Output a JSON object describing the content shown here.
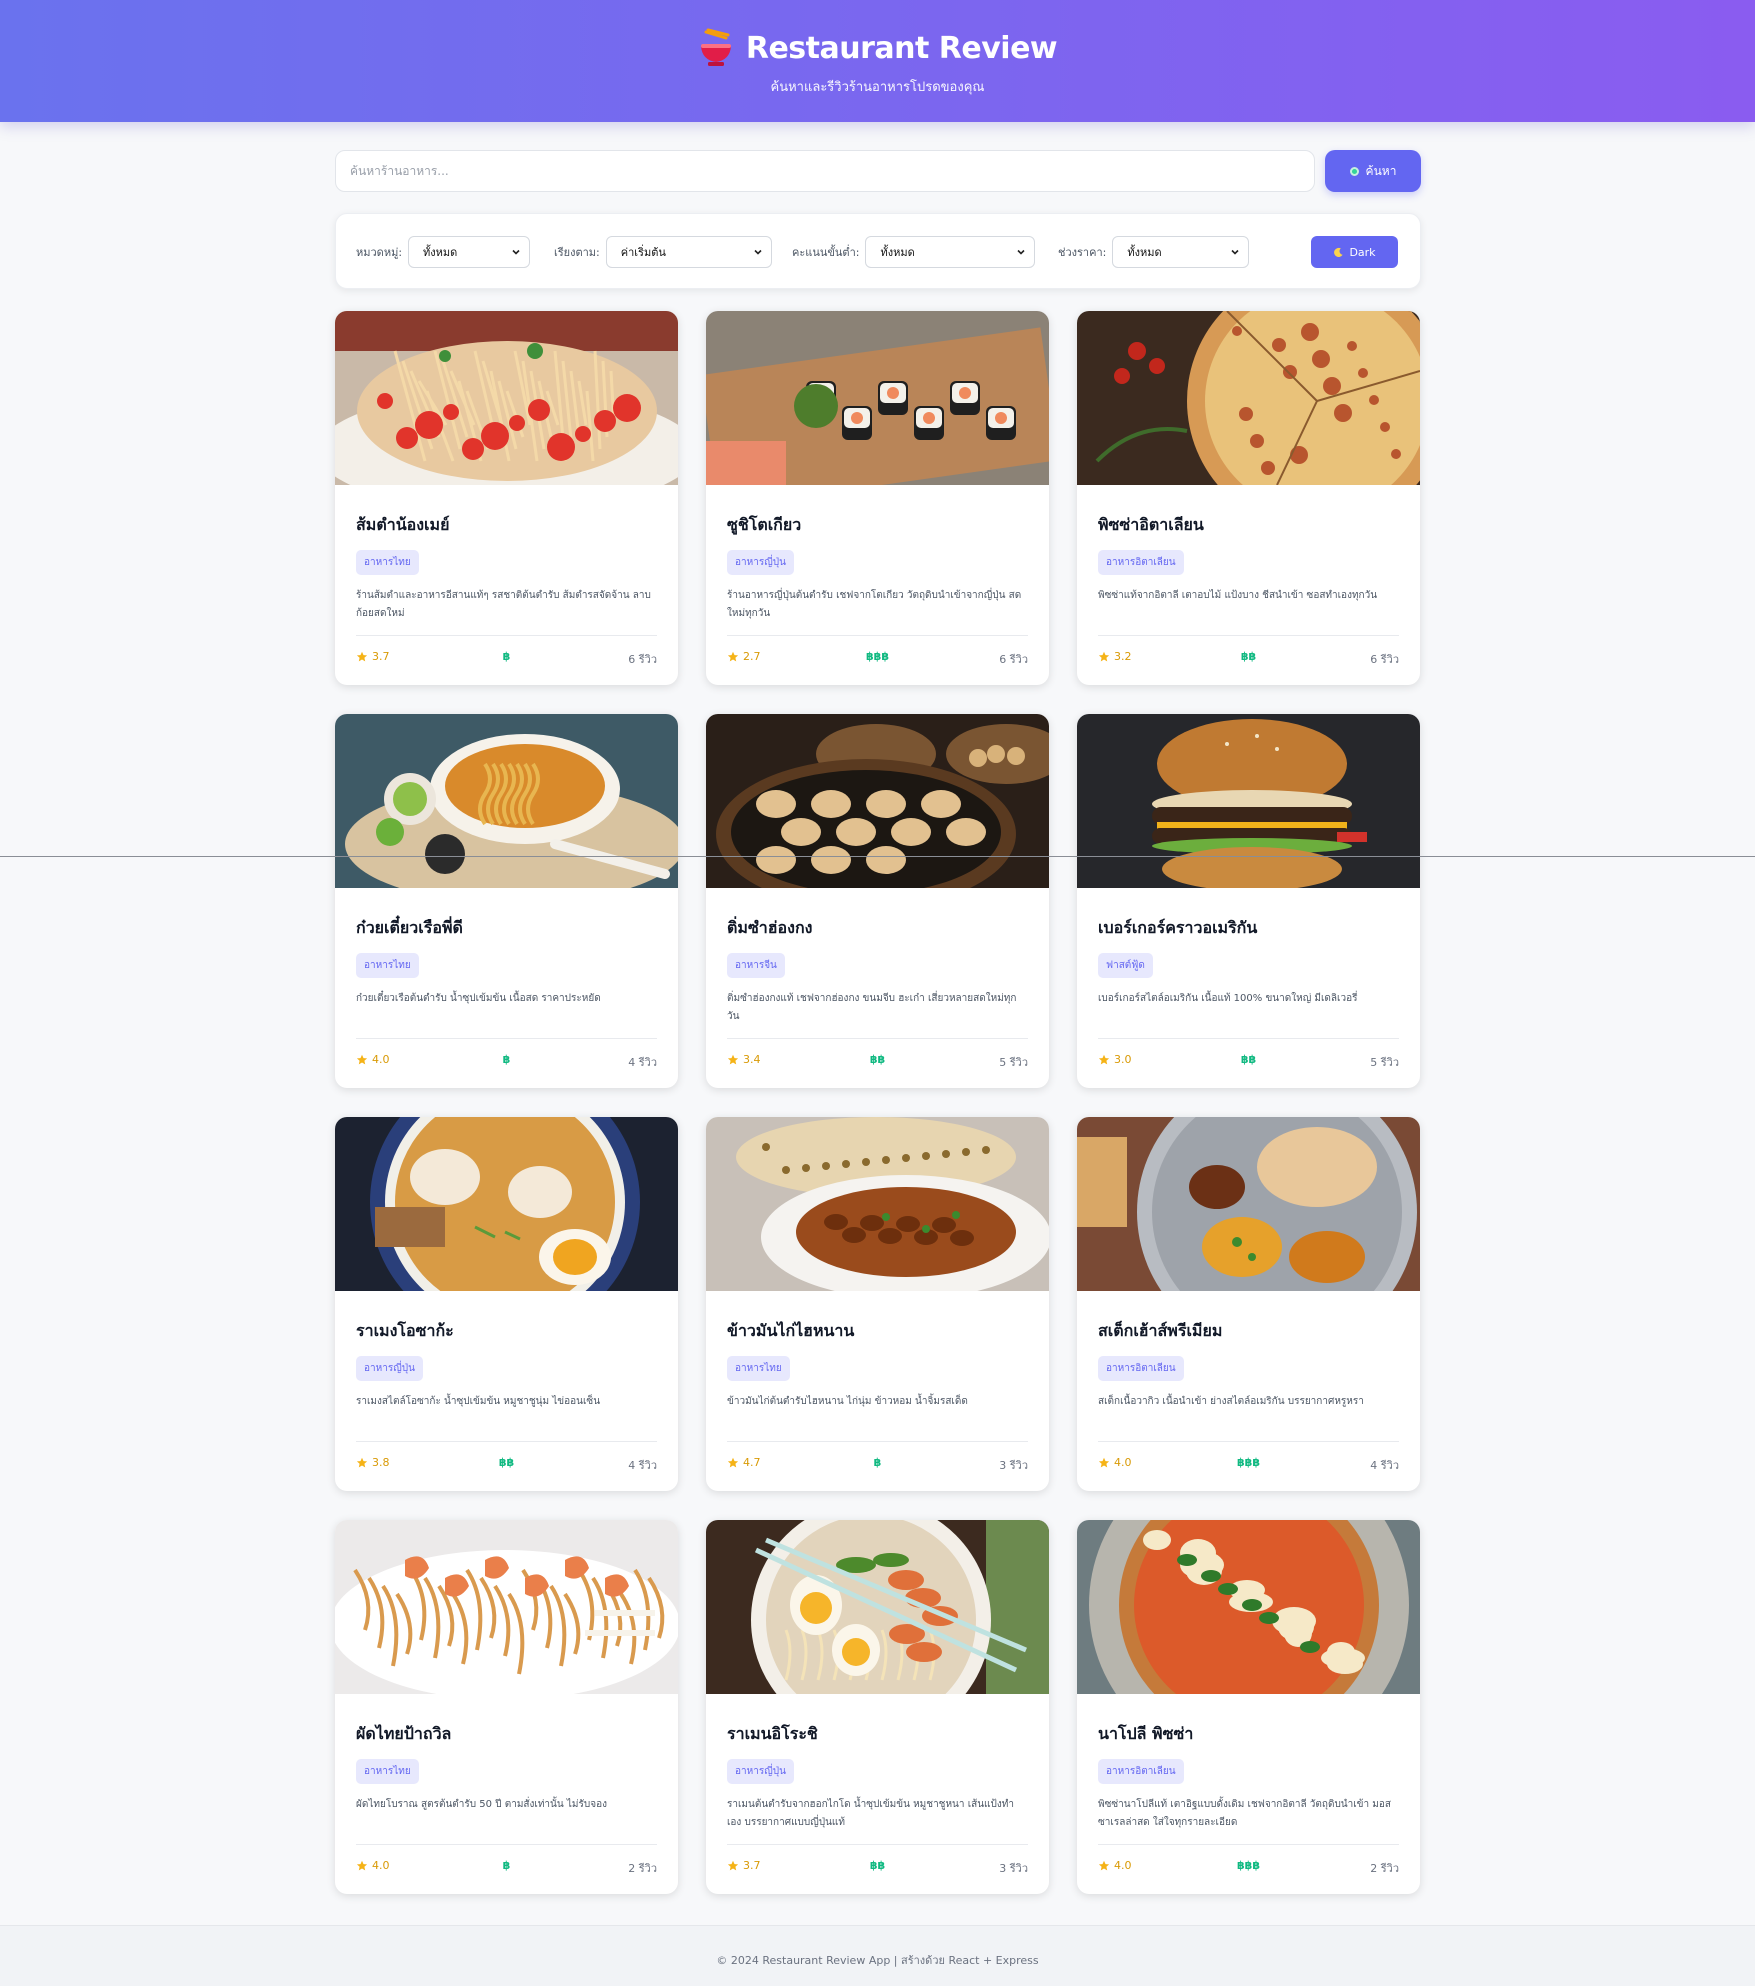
{
  "header": {
    "title": "Restaurant Review",
    "subtitle": "ค้นหาและรีวิวร้านอาหารโปรดของคุณ"
  },
  "search": {
    "placeholder": "ค้นหาร้านอาหาร...",
    "button_label": "ค้นหา"
  },
  "filters": {
    "category": {
      "label": "หมวดหมู่:",
      "value": "ทั้งหมด"
    },
    "sort": {
      "label": "เรียงตาม:",
      "value": "ค่าเริ่มต้น"
    },
    "min_rating": {
      "label": "คะแนนขั้นต่ำ:",
      "value": "ทั้งหมด"
    },
    "price_range": {
      "label": "ช่วงราคา:",
      "value": "ทั้งหมด"
    },
    "dark_label": "Dark"
  },
  "restaurants": [
    {
      "name": "ส้มตำน้องเมย์",
      "category": "อาหารไทย",
      "description": "ร้านส้มตำและอาหารอีสานแท้ๆ รสชาติต้นตำรับ ส้มตำรสจัดจ้าน ลาบก้อยสดใหม่",
      "rating": "3.7",
      "price": "฿",
      "reviews": "6 รีวิว",
      "image": "papaya-salad"
    },
    {
      "name": "ซูชิโตเกียว",
      "category": "อาหารญี่ปุ่น",
      "description": "ร้านอาหารญี่ปุ่นต้นตำรับ เชฟจากโตเกียว วัตถุดิบนำเข้าจากญี่ปุ่น สดใหม่ทุกวัน",
      "rating": "2.7",
      "price": "฿฿฿",
      "reviews": "6 รีวิว",
      "image": "sushi"
    },
    {
      "name": "พิซซ่าอิตาเลียน",
      "category": "อาหารอิตาเลียน",
      "description": "พิซซ่าแท้จากอิตาลี เตาอบไม้ แป้งบาง ชีสนำเข้า ซอสทำเองทุกวัน",
      "rating": "3.2",
      "price": "฿฿",
      "reviews": "6 รีวิว",
      "image": "pizza"
    },
    {
      "name": "ก๋วยเตี๋ยวเรือพี่ดี",
      "category": "อาหารไทย",
      "description": "ก๋วยเตี๋ยวเรือต้นตำรับ น้ำซุปเข้มข้น เนื้อสด ราคาประหยัด",
      "rating": "4.0",
      "price": "฿",
      "reviews": "4 รีวิว",
      "image": "noodle-soup"
    },
    {
      "name": "ติ่มซำฮ่องกง",
      "category": "อาหารจีน",
      "description": "ติ่มซำฮ่องกงแท้ เชฟจากฮ่องกง ขนมจีบ ฮะเก๋า เสี่ยวหลายสดใหม่ทุกวัน",
      "rating": "3.4",
      "price": "฿฿",
      "reviews": "5 รีวิว",
      "image": "dimsum"
    },
    {
      "name": "เบอร์เกอร์คราวอเมริกัน",
      "category": "ฟาสต์ฟู้ด",
      "description": "เบอร์เกอร์สไตล์อเมริกัน เนื้อแท้ 100% ขนาดใหญ่ มีเดลิเวอรี่",
      "rating": "3.0",
      "price": "฿฿",
      "reviews": "5 รีวิว",
      "image": "burger"
    },
    {
      "name": "ราเมงโอซาก้ะ",
      "category": "อาหารญี่ปุ่น",
      "description": "ราเมงสไตล์โอซาก้ะ น้ำซุปเข้มข้น หมูชาชูนุ่ม ไข่ออนเซ็น",
      "rating": "3.8",
      "price": "฿฿",
      "reviews": "4 รีวิว",
      "image": "ramen"
    },
    {
      "name": "ข้าวมันไก่ไฮหนาน",
      "category": "อาหารไทย",
      "description": "ข้าวมันไก่ต้นตำรับไฮหนาน ไก่นุ่ม ข้าวหอม น้ำจิ้มรสเด็ด",
      "rating": "4.7",
      "price": "฿",
      "reviews": "3 รีวิว",
      "image": "curry-naan"
    },
    {
      "name": "สเต็กเฮ้าส์พรีเมียม",
      "category": "อาหารอิตาเลียน",
      "description": "สเต็กเนื้อวากิว เนื้อนำเข้า ย่างสไตล์อเมริกัน บรรยากาศหรูหรา",
      "rating": "4.0",
      "price": "฿฿฿",
      "reviews": "4 รีวิว",
      "image": "thali"
    },
    {
      "name": "ผัดไทยป้าถวิล",
      "category": "อาหารไทย",
      "description": "ผัดไทยโบราณ สูตรต้นตำรับ 50 ปี ตามสั่งเท่านั้น ไม่รับจอง",
      "rating": "4.0",
      "price": "฿",
      "reviews": "2 รีวิว",
      "image": "pad-thai"
    },
    {
      "name": "ราเมนอิโระชิ",
      "category": "อาหารญี่ปุ่น",
      "description": "ราเมนต้นตำรับจากฮอกไกโด น้ำซุปเข้มข้น หมูชาชูหนา เส้นแป้งทำเอง บรรยากาศแบบญี่ปุ่นแท้",
      "rating": "3.7",
      "price": "฿฿",
      "reviews": "3 รีวิว",
      "image": "ramen-bowl"
    },
    {
      "name": "นาโปลี พิซซ่า",
      "category": "อาหารอิตาเลียน",
      "description": "พิซซ่านาโปลีแท้ เตาอิฐแบบดั้งเดิม เชฟจากอิตาลี วัตถุดิบนำเข้า มอสซาเรลล่าสด ใส่ใจทุกรายละเอียด",
      "rating": "4.0",
      "price": "฿฿฿",
      "reviews": "2 รีวิว",
      "image": "margherita"
    }
  ],
  "footer": {
    "text": "© 2024 Restaurant Review App | สร้างด้วย React + Express"
  }
}
